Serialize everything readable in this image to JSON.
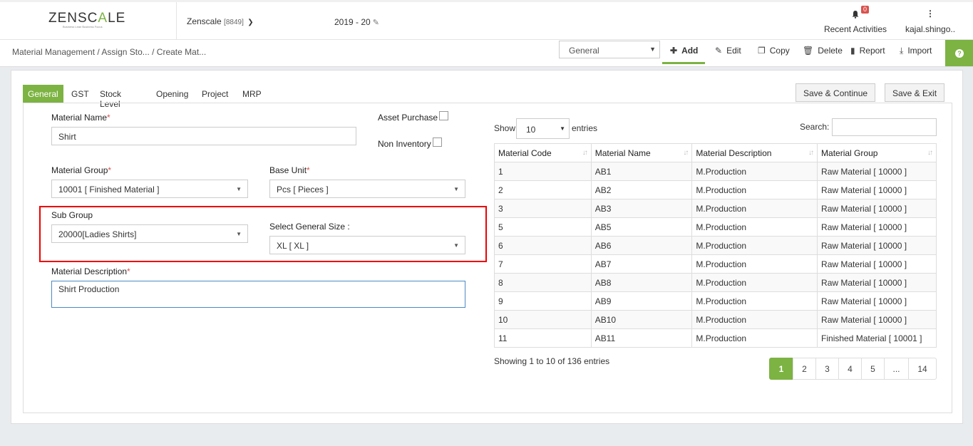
{
  "header": {
    "logo_text_a": "ZENSC",
    "logo_text_b": "A",
    "logo_text_c": "LE",
    "logo_tagline": "Business Lean Business Focus",
    "company_name": "Zenscale",
    "company_code": "[8849]",
    "fiscal_year": "2019 - 20",
    "notification_count": "0",
    "recent_activities": "Recent Activities",
    "user_name": "kajal.shingo.."
  },
  "breadcrumb": {
    "root": "Material Management",
    "level2": "/ Assign Sto...",
    "level3": "/ Create Mat..."
  },
  "toolbar": {
    "view_select": "General",
    "add": "Add",
    "edit": "Edit",
    "copy": "Copy",
    "delete": "Delete",
    "report": "Report",
    "import": "Import",
    "accent_color": "#7cb342"
  },
  "tabs": [
    "General",
    "GST",
    "Stock Level",
    "Opening",
    "Project",
    "MRP"
  ],
  "actions": {
    "save_continue": "Save & Continue",
    "save_exit": "Save & Exit"
  },
  "form": {
    "material_name_label": "Material Name",
    "material_name_value": "Shirt",
    "asset_purchase_label": "Asset Purchase",
    "non_inventory_label": "Non Inventory",
    "material_group_label": "Material Group",
    "material_group_value": "10001 [ Finished Material ]",
    "base_unit_label": "Base Unit",
    "base_unit_value": "Pcs [ Pieces ]",
    "sub_group_label": "Sub Group",
    "sub_group_value": "20000[Ladies Shirts]",
    "general_size_label": "Select General Size :",
    "general_size_value": "XL [ XL ]",
    "description_label": "Material Description",
    "description_value": "Shirt Production",
    "required_mark": "*"
  },
  "table": {
    "show_label": "Show",
    "entries_value": "10",
    "entries_label": "entries",
    "search_label": "Search:",
    "columns": [
      "Material Code",
      "Material Name",
      "Material Description",
      "Material Group"
    ],
    "rows": [
      [
        "1",
        "AB1",
        "M.Production",
        "Raw Material [ 10000 ]"
      ],
      [
        "2",
        "AB2",
        "M.Production",
        "Raw Material [ 10000 ]"
      ],
      [
        "3",
        "AB3",
        "M.Production",
        "Raw Material [ 10000 ]"
      ],
      [
        "5",
        "AB5",
        "M.Production",
        "Raw Material [ 10000 ]"
      ],
      [
        "6",
        "AB6",
        "M.Production",
        "Raw Material [ 10000 ]"
      ],
      [
        "7",
        "AB7",
        "M.Production",
        "Raw Material [ 10000 ]"
      ],
      [
        "8",
        "AB8",
        "M.Production",
        "Raw Material [ 10000 ]"
      ],
      [
        "9",
        "AB9",
        "M.Production",
        "Raw Material [ 10000 ]"
      ],
      [
        "10",
        "AB10",
        "M.Production",
        "Raw Material [ 10000 ]"
      ],
      [
        "11",
        "AB11",
        "M.Production",
        "Finished Material [ 10001 ]"
      ]
    ],
    "showing_text": "Showing 1 to 10 of 136 entries",
    "pages": [
      "1",
      "2",
      "3",
      "4",
      "5",
      "...",
      "14"
    ]
  }
}
